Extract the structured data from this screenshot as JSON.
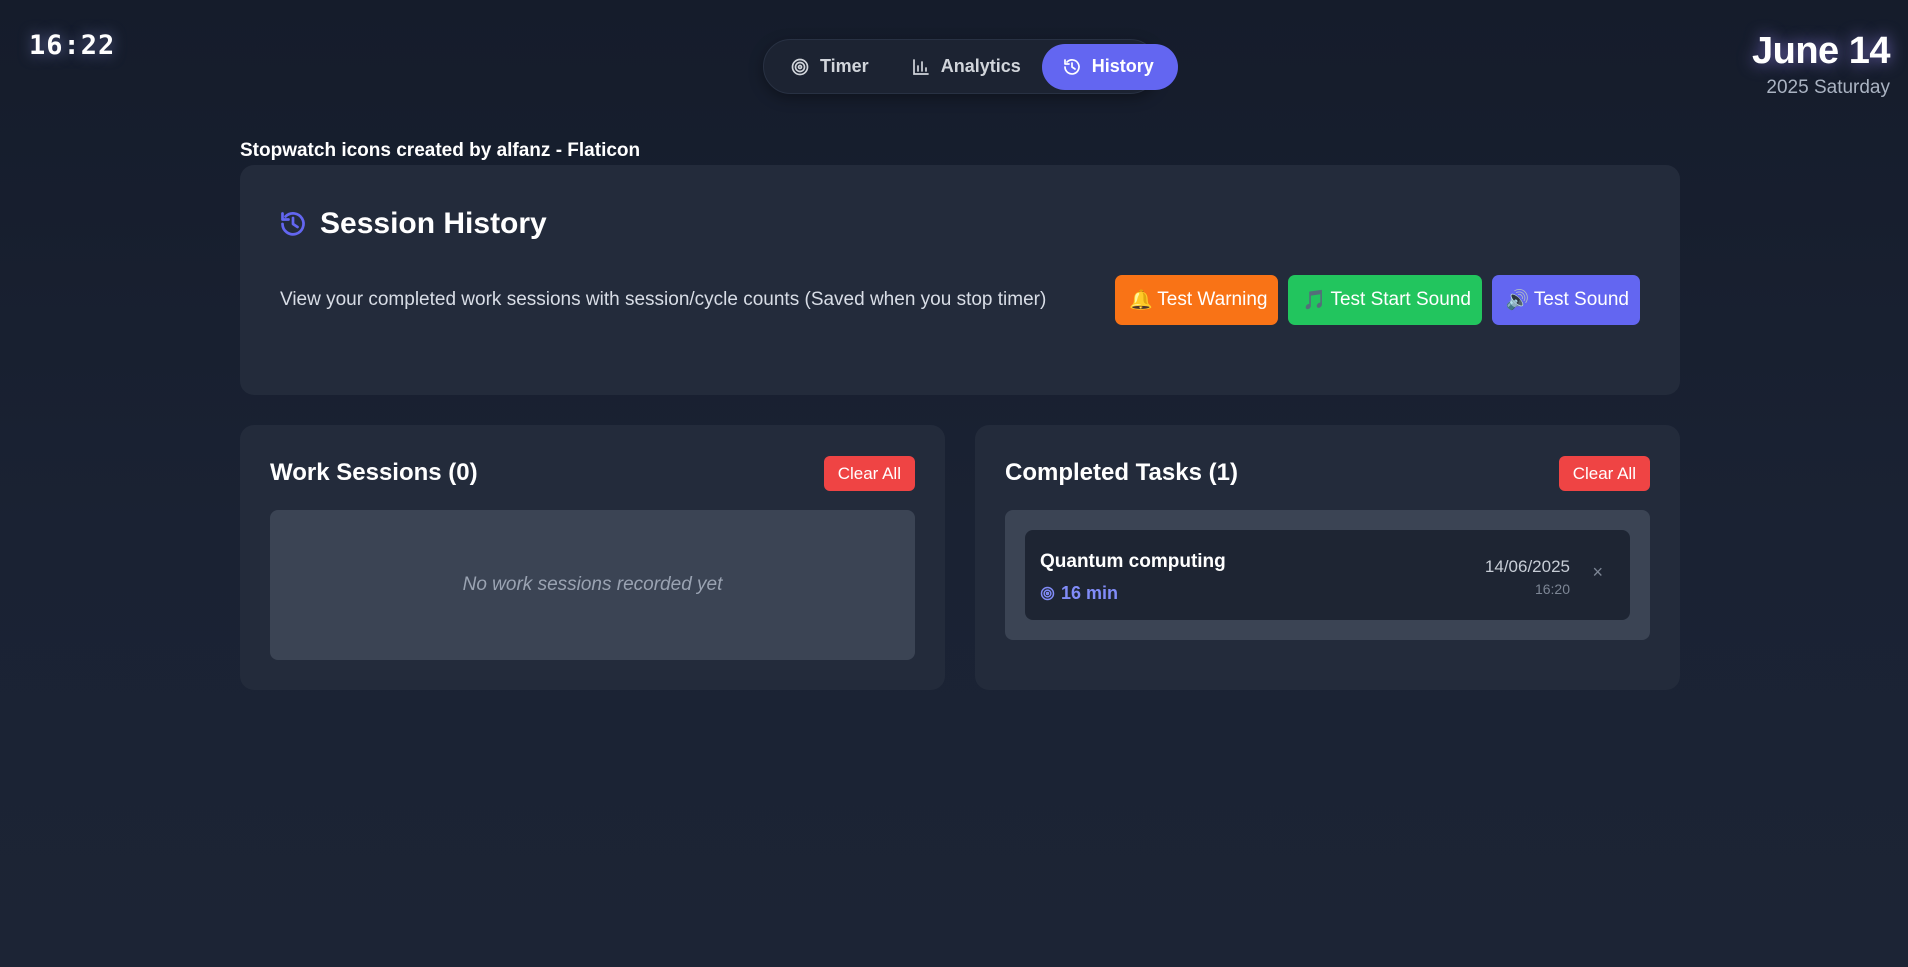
{
  "clock": "16:22",
  "date": {
    "main": "June 14",
    "sub": "2025 Saturday"
  },
  "nav": {
    "items": [
      {
        "label": "Timer",
        "icon": "target-icon",
        "active": false
      },
      {
        "label": "Analytics",
        "icon": "bar-chart-icon",
        "active": false
      },
      {
        "label": "History",
        "icon": "history-icon",
        "active": true
      }
    ]
  },
  "credit": "Stopwatch icons created by alfanz - Flaticon",
  "session_history": {
    "title": "Session History",
    "description": "View your completed work sessions with session/cycle counts (Saved when you stop timer)",
    "buttons": [
      {
        "label": "Test Warning",
        "icon": "bell-icon",
        "color": "#f97316"
      },
      {
        "label": "Test Start Sound",
        "icon": "music-note-icon",
        "color": "#22c55e"
      },
      {
        "label": "Test Sound",
        "icon": "speaker-icon",
        "color": "#6366f1"
      }
    ]
  },
  "work_sessions": {
    "title": "Work Sessions (0)",
    "clear_label": "Clear All",
    "empty_text": "No work sessions recorded yet"
  },
  "completed_tasks": {
    "title": "Completed Tasks (1)",
    "clear_label": "Clear All",
    "items": [
      {
        "name": "Quantum computing",
        "duration": "16 min",
        "date": "14/06/2025",
        "time": "16:20",
        "remove": "×"
      }
    ]
  },
  "colors": {
    "accent": "#6366f1",
    "danger": "#ef4444",
    "warning": "#f97316",
    "success": "#22c55e"
  }
}
